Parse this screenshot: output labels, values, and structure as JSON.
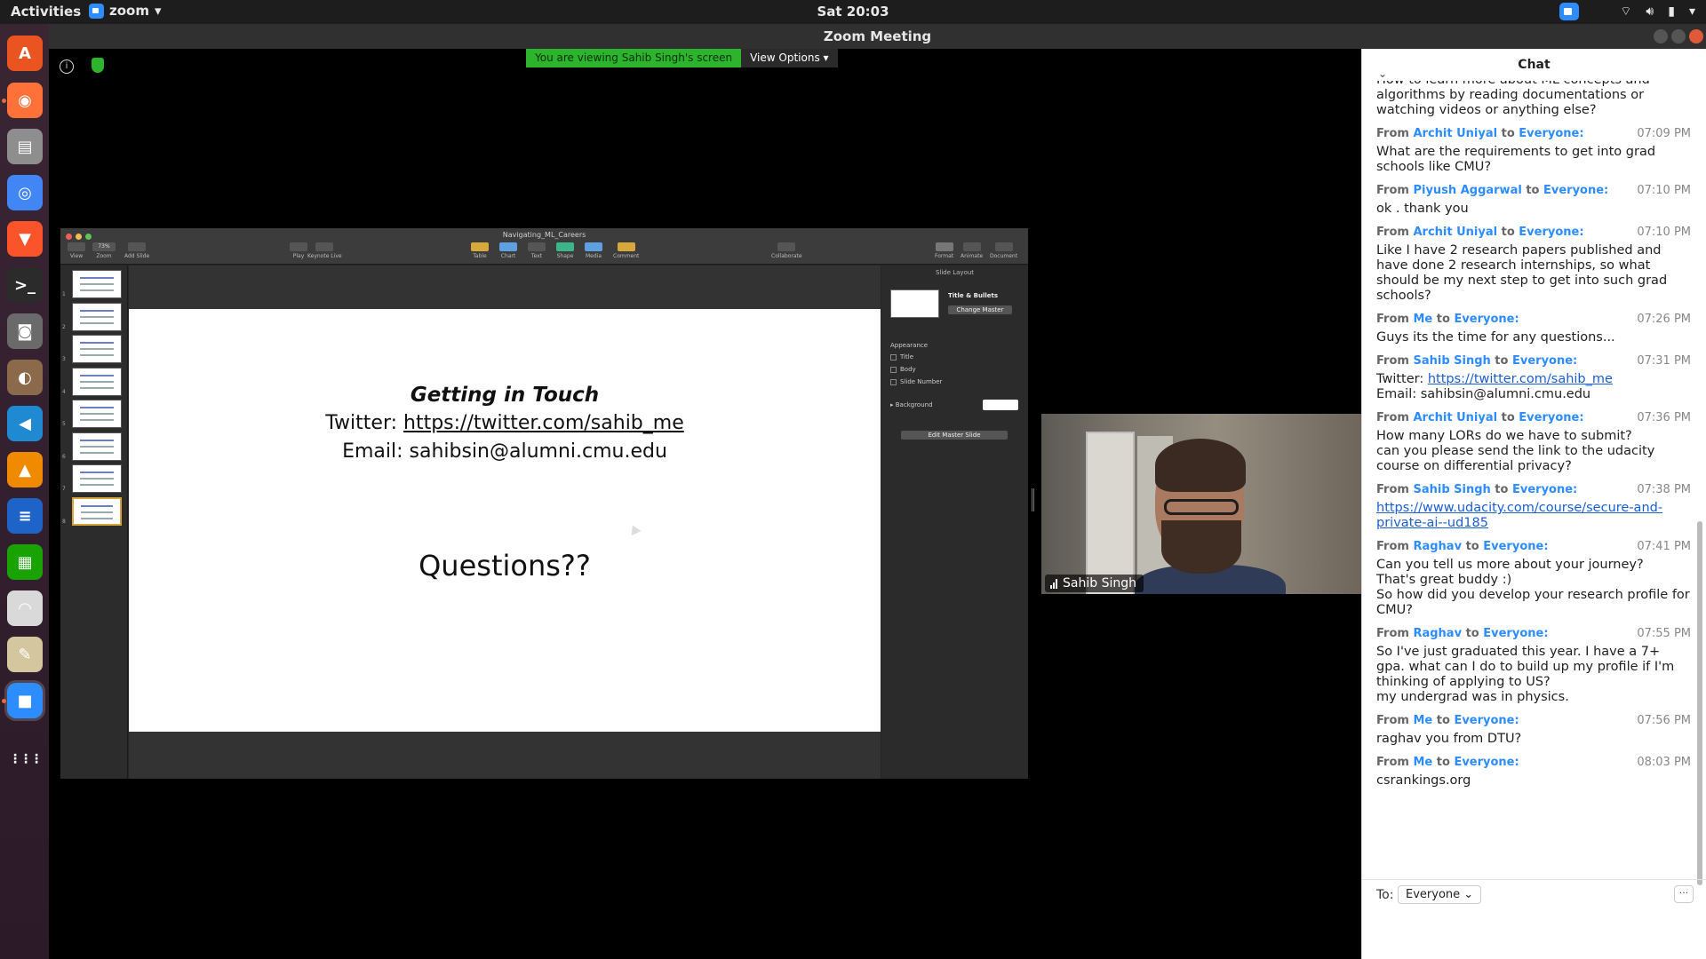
{
  "topbar": {
    "activities": "Activities",
    "app_name": "zoom",
    "clock": "Sat 20:03"
  },
  "window": {
    "title": "Zoom Meeting"
  },
  "dock": {
    "items": [
      {
        "name": "ubuntu-software",
        "color": "#e95420",
        "glyph": "A"
      },
      {
        "name": "firefox",
        "color": "#ff7139",
        "glyph": "◉"
      },
      {
        "name": "files",
        "color": "#8e8e8e",
        "glyph": "▤"
      },
      {
        "name": "chrome",
        "color": "#4285f4",
        "glyph": "◎"
      },
      {
        "name": "brave",
        "color": "#fb542b",
        "glyph": "▼"
      },
      {
        "name": "terminal",
        "color": "#2b2b2b",
        "glyph": ">_"
      },
      {
        "name": "camera",
        "color": "#6a6a6a",
        "glyph": "◙"
      },
      {
        "name": "shotwell",
        "color": "#8a6a4a",
        "glyph": "◐"
      },
      {
        "name": "vscode",
        "color": "#1f8ad2",
        "glyph": "◀"
      },
      {
        "name": "vlc",
        "color": "#f08a00",
        "glyph": "▲"
      },
      {
        "name": "writer",
        "color": "#1e64c8",
        "glyph": "≡"
      },
      {
        "name": "calc",
        "color": "#18a303",
        "glyph": "▦"
      },
      {
        "name": "evince",
        "color": "#d9d9d9",
        "glyph": "◠"
      },
      {
        "name": "text-editor",
        "color": "#d4c7a0",
        "glyph": "✎"
      },
      {
        "name": "zoom",
        "color": "#2d8cff",
        "glyph": "■"
      },
      {
        "name": "show-apps",
        "color": "transparent",
        "glyph": "⋮⋮⋮"
      }
    ]
  },
  "share": {
    "banner": "You are viewing Sahib Singh's screen",
    "view_options": "View Options"
  },
  "keynote": {
    "doc_title": "Navigating_ML_Careers",
    "zoom_level": "73%",
    "tools": {
      "view": "View",
      "zoom": "Zoom",
      "add_slide": "Add Slide",
      "play": "Play",
      "keynote_live": "Keynote Live",
      "table": "Table",
      "chart": "Chart",
      "text": "Text",
      "shape": "Shape",
      "media": "Media",
      "comment": "Comment",
      "collaborate": "Collaborate",
      "format": "Format",
      "animate": "Animate",
      "document": "Document"
    },
    "thumb_numbers": [
      "1",
      "2",
      "3",
      "4",
      "5",
      "6",
      "7",
      "8"
    ],
    "slide": {
      "title": "Getting in Touch",
      "twitter_prefix": "Twitter: ",
      "twitter_link": "https://twitter.com/sahib_me",
      "email": "Email: sahibsin@alumni.cmu.edu",
      "questions": "Questions??"
    },
    "inspector": {
      "header": "Slide Layout",
      "layout_name": "Title & Bullets",
      "change_master": "Change Master",
      "appearance": "Appearance",
      "title": "Title",
      "body": "Body",
      "slide_number": "Slide Number",
      "background": "Background",
      "edit_master": "Edit Master Slide"
    }
  },
  "video": {
    "participant": "Sahib Singh"
  },
  "chat": {
    "header": "Chat",
    "messages": [
      {
        "who": "",
        "to": "",
        "time": "",
        "body": "How to learn more about ML concepts and algorithms by reading documentations or watching videos or anything else?",
        "partial": true
      },
      {
        "who": "Archit Uniyal",
        "to": "Everyone:",
        "time": "07:09 PM",
        "body": "What are the requirements to get into grad schools like CMU?"
      },
      {
        "who": "Piyush Aggarwal",
        "to": "Everyone:",
        "time": "07:10 PM",
        "body": "ok . thank you"
      },
      {
        "who": "Archit Uniyal",
        "to": "Everyone:",
        "time": "07:10 PM",
        "body": "Like I have 2 research papers published and have done 2 research internships, so what should be my next step to get into such grad schools?"
      },
      {
        "who": "Me",
        "to": "Everyone:",
        "time": "07:26 PM",
        "body": "Guys its the time for any questions..."
      },
      {
        "who": "Sahib Singh",
        "to": "Everyone:",
        "time": "07:31 PM",
        "body_prefix": "Twitter: ",
        "link": "https://twitter.com/sahib_me",
        "body_suffix": "Email: sahibsin@alumni.cmu.edu"
      },
      {
        "who": "Archit Uniyal",
        "to": "Everyone:",
        "time": "07:36 PM",
        "body": "How many LORs do we have to submit?\ncan you please send the link to the udacity course on differential privacy?"
      },
      {
        "who": "Sahib Singh",
        "to": "Everyone:",
        "time": "07:38 PM",
        "link_only": "https://www.udacity.com/course/secure-and-private-ai--ud185"
      },
      {
        "who": "Raghav",
        "to": "Everyone:",
        "time": "07:41 PM",
        "body": "Can you tell us more about your journey?\nThat's great buddy :)\nSo how did you develop your research profile for CMU?"
      },
      {
        "who": "Raghav",
        "to": "Everyone:",
        "time": "07:55 PM",
        "body": "So I've just graduated this year. I have a 7+ gpa. what can I do to build up my profile if I'm thinking of applying to US?\nmy undergrad was in physics."
      },
      {
        "who": "Me",
        "to": "Everyone:",
        "time": "07:56 PM",
        "body": "raghav you from DTU?"
      },
      {
        "who": "Me",
        "to": "Everyone:",
        "time": "08:03 PM",
        "body": "csrankings.org"
      }
    ],
    "from_label": "From",
    "to_word": "to",
    "footer": {
      "to_label": "To:",
      "recipient": "Everyone",
      "more": "···"
    }
  }
}
